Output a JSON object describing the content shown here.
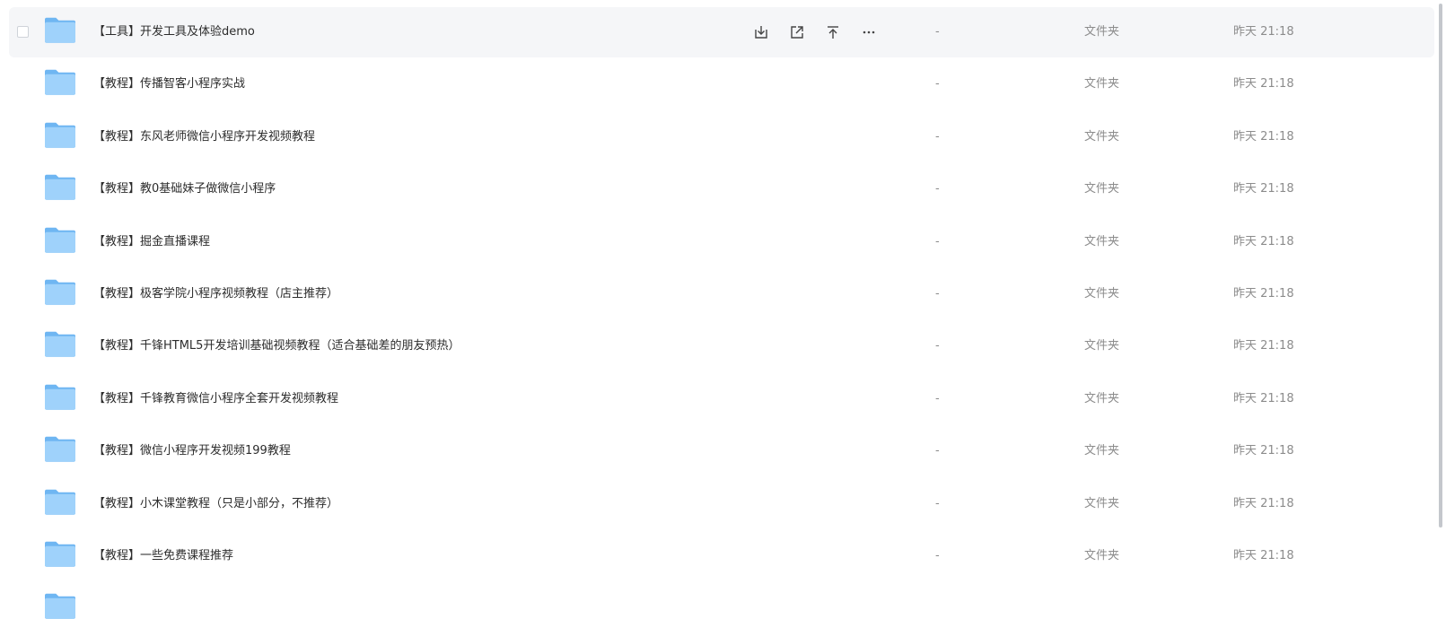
{
  "files": [
    {
      "name": "【工具】开发工具及体验demo",
      "size": "-",
      "type": "文件夹",
      "modified": "昨天 21:18",
      "hovered": true
    },
    {
      "name": "【教程】传播智客小程序实战",
      "size": "-",
      "type": "文件夹",
      "modified": "昨天 21:18"
    },
    {
      "name": "【教程】东风老师微信小程序开发视频教程",
      "size": "-",
      "type": "文件夹",
      "modified": "昨天 21:18"
    },
    {
      "name": "【教程】教0基础妹子做微信小程序",
      "size": "-",
      "type": "文件夹",
      "modified": "昨天 21:18"
    },
    {
      "name": "【教程】掘金直播课程",
      "size": "-",
      "type": "文件夹",
      "modified": "昨天 21:18"
    },
    {
      "name": "【教程】极客学院小程序视频教程（店主推荐）",
      "size": "-",
      "type": "文件夹",
      "modified": "昨天 21:18"
    },
    {
      "name": "【教程】千锋HTML5开发培训基础视频教程（适合基础差的朋友预热）",
      "size": "-",
      "type": "文件夹",
      "modified": "昨天 21:18"
    },
    {
      "name": "【教程】千锋教育微信小程序全套开发视频教程",
      "size": "-",
      "type": "文件夹",
      "modified": "昨天 21:18"
    },
    {
      "name": "【教程】微信小程序开发视频199教程",
      "size": "-",
      "type": "文件夹",
      "modified": "昨天 21:18"
    },
    {
      "name": "【教程】小木课堂教程（只是小部分，不推荐）",
      "size": "-",
      "type": "文件夹",
      "modified": "昨天 21:18"
    },
    {
      "name": "【教程】一些免费课程推荐",
      "size": "-",
      "type": "文件夹",
      "modified": "昨天 21:18"
    },
    {
      "name": "",
      "size": "",
      "type": "",
      "modified": ""
    }
  ],
  "row_actions": [
    {
      "icon": "download-icon"
    },
    {
      "icon": "share-icon"
    },
    {
      "icon": "move-up-icon"
    },
    {
      "icon": "more-icon"
    }
  ],
  "colors": {
    "folder_light": "#9fd2fb",
    "folder_dark": "#6fb6f2",
    "hover_bg": "#f5f6f8",
    "text_primary": "#2c2c2c",
    "text_secondary": "#8c8c8c"
  }
}
